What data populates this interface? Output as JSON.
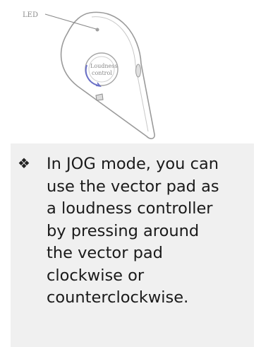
{
  "figure": {
    "led_label": "LED",
    "knob_label_line1": "Loudness",
    "knob_label_line2": "control"
  },
  "bullet": {
    "icon": "diamond-bullet-icon",
    "text": "In JOG mode, you can\nuse the vector pad as\na loudness controller\nby pressing around\nthe vector pad\nclockwise or\ncounterclockwise."
  }
}
